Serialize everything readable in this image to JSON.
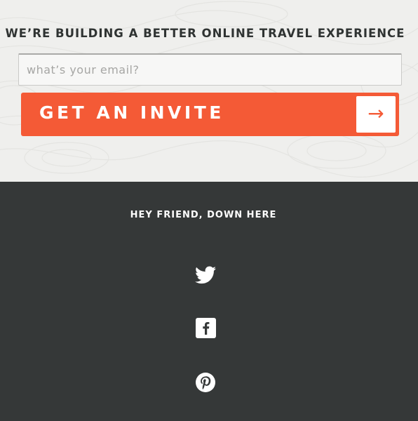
{
  "hero": {
    "headline": "WE’RE BUILDING A BETTER ONLINE TRAVEL EXPERIENCE",
    "email_placeholder": "what’s your email?",
    "email_value": "",
    "invite_label": "GET AN INVITE",
    "submit_glyph": "→"
  },
  "footer": {
    "heading": "HEY FRIEND, DOWN HERE",
    "social": [
      {
        "icon": "twitter-icon"
      },
      {
        "icon": "facebook-icon"
      },
      {
        "icon": "pinterest-icon"
      }
    ]
  },
  "colors": {
    "accent": "#f45a36",
    "footer_bg": "#353838",
    "hero_bg": "#efefed",
    "headline_text": "#2f3332"
  }
}
